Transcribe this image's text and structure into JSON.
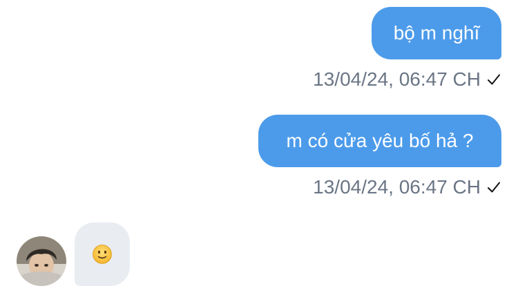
{
  "messages": [
    {
      "text": "bộ m nghĩ",
      "timestamp": "13/04/24, 06:47 CH",
      "status_icon": "check-icon"
    },
    {
      "text": "m có cửa yêu bố hả ?",
      "timestamp": "13/04/24, 06:47 CH",
      "status_icon": "check-icon"
    }
  ],
  "incoming": {
    "avatar_icon": "user-avatar",
    "content_icon": "slightly-smiling-face-emoji"
  },
  "colors": {
    "outgoing_bubble": "#4c9bea",
    "incoming_bubble": "#e9edf2",
    "timestamp_text": "#6a7585"
  }
}
